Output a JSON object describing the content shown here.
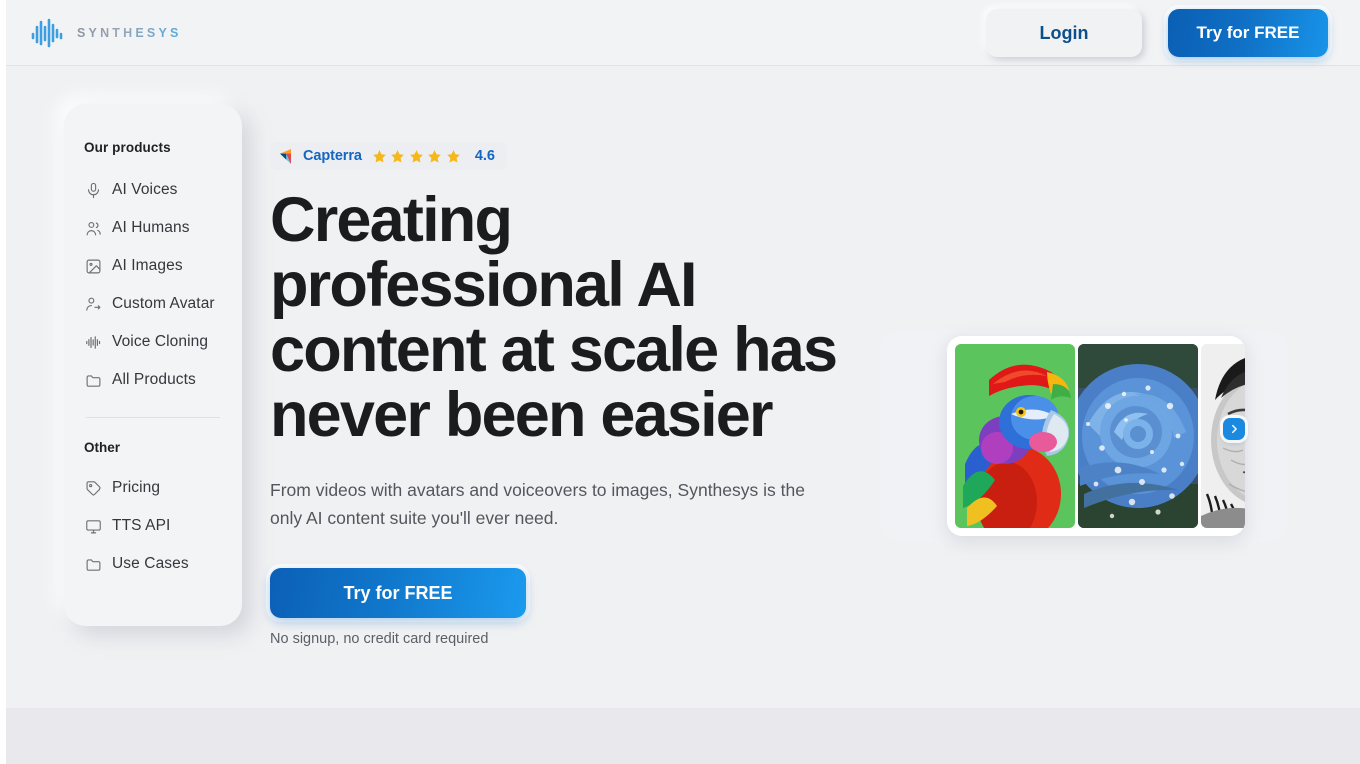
{
  "header": {
    "logo_text": "SYNTHESYS",
    "logo_icon": "waveform-icon",
    "login_label": "Login",
    "trial_label": "Try for FREE"
  },
  "sidebar": {
    "products_heading": "Our products",
    "products": [
      {
        "label": "AI Voices",
        "icon": "microphone-icon"
      },
      {
        "label": "AI Humans",
        "icon": "users-icon"
      },
      {
        "label": "AI Images",
        "icon": "image-icon"
      },
      {
        "label": "Custom Avatar",
        "icon": "user-swap-icon"
      },
      {
        "label": "Voice Cloning",
        "icon": "waveform-icon"
      },
      {
        "label": "All Products",
        "icon": "folder-icon"
      }
    ],
    "other_heading": "Other",
    "other": [
      {
        "label": "Pricing",
        "icon": "tag-icon"
      },
      {
        "label": "TTS API",
        "icon": "monitor-icon"
      },
      {
        "label": "Use Cases",
        "icon": "folder-icon"
      }
    ]
  },
  "hero": {
    "badge": {
      "brand": "Capterra",
      "brand_icon": "capterra-logo-icon",
      "score": "4.6",
      "stars": 5,
      "star_icon": "star-icon"
    },
    "headline": "Creating professional AI content at scale has never been easier",
    "subtitle": "From videos with avatars and voiceovers to images, Synthesys is the only AI content suite you'll ever need.",
    "cta_label": "Try for FREE",
    "cta_note": "No signup, no credit card required"
  },
  "carousel": {
    "next_icon": "chevron-right-icon",
    "slides": [
      {
        "alt": "colorful parrot wearing a red beret on green background"
      },
      {
        "alt": "blue rose with water droplets"
      },
      {
        "alt": "black and white portrait of an elderly person"
      }
    ]
  },
  "colors": {
    "accent_blue": "#1077cb",
    "accent_blue_light": "#1b9aee",
    "link_blue": "#1566c0",
    "star_gold": "#f6b718",
    "page_bg": "#f0f1f3",
    "band_bg": "#e8e8ed",
    "text_dark": "#1b1c1e"
  }
}
